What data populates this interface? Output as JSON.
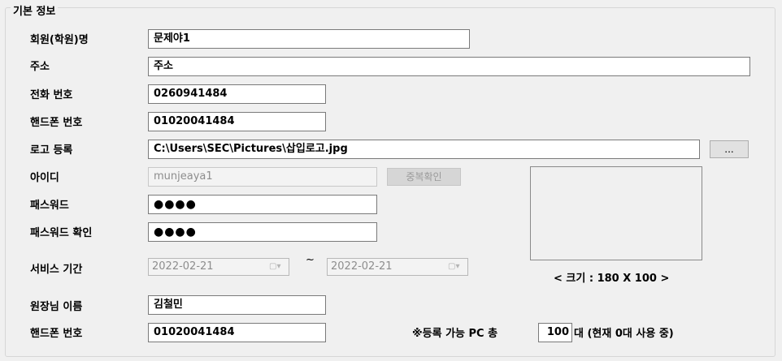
{
  "group_title": "기본 정보",
  "labels": {
    "member_name": "회원(학원)명",
    "address": "주소",
    "phone": "전화 번호",
    "mobile": "핸드폰 번호",
    "logo": "로고 등록",
    "user_id": "아이디",
    "password": "패스워드",
    "password_confirm": "패스워드 확인",
    "service_period": "서비스 기간",
    "director_name": "원장님 이름",
    "director_mobile": "핸드폰 번호"
  },
  "values": {
    "member_name": "문제야1",
    "address": "주소",
    "phone": "0260941484",
    "mobile": "01020041484",
    "logo_path": "C:\\Users\\SEC\\Pictures\\삽입로고.jpg",
    "user_id": "munjeaya1",
    "password": "●●●●",
    "password_confirm": "●●●●",
    "service_start": "2022-02-21",
    "service_end": "2022-02-21",
    "director_name": "김철민",
    "director_mobile": "01020041484",
    "pc_count": "100"
  },
  "buttons": {
    "browse": "...",
    "dup_check": "중복확인"
  },
  "text": {
    "tilde": "~",
    "logo_size": "< 크기 : 180 X 100 >",
    "pc_label": "※등록 가능 PC 총",
    "pc_suffix": "대 (현재 0대 사용 중)"
  },
  "icons": {
    "calendar": "calendar-dropdown-icon"
  }
}
